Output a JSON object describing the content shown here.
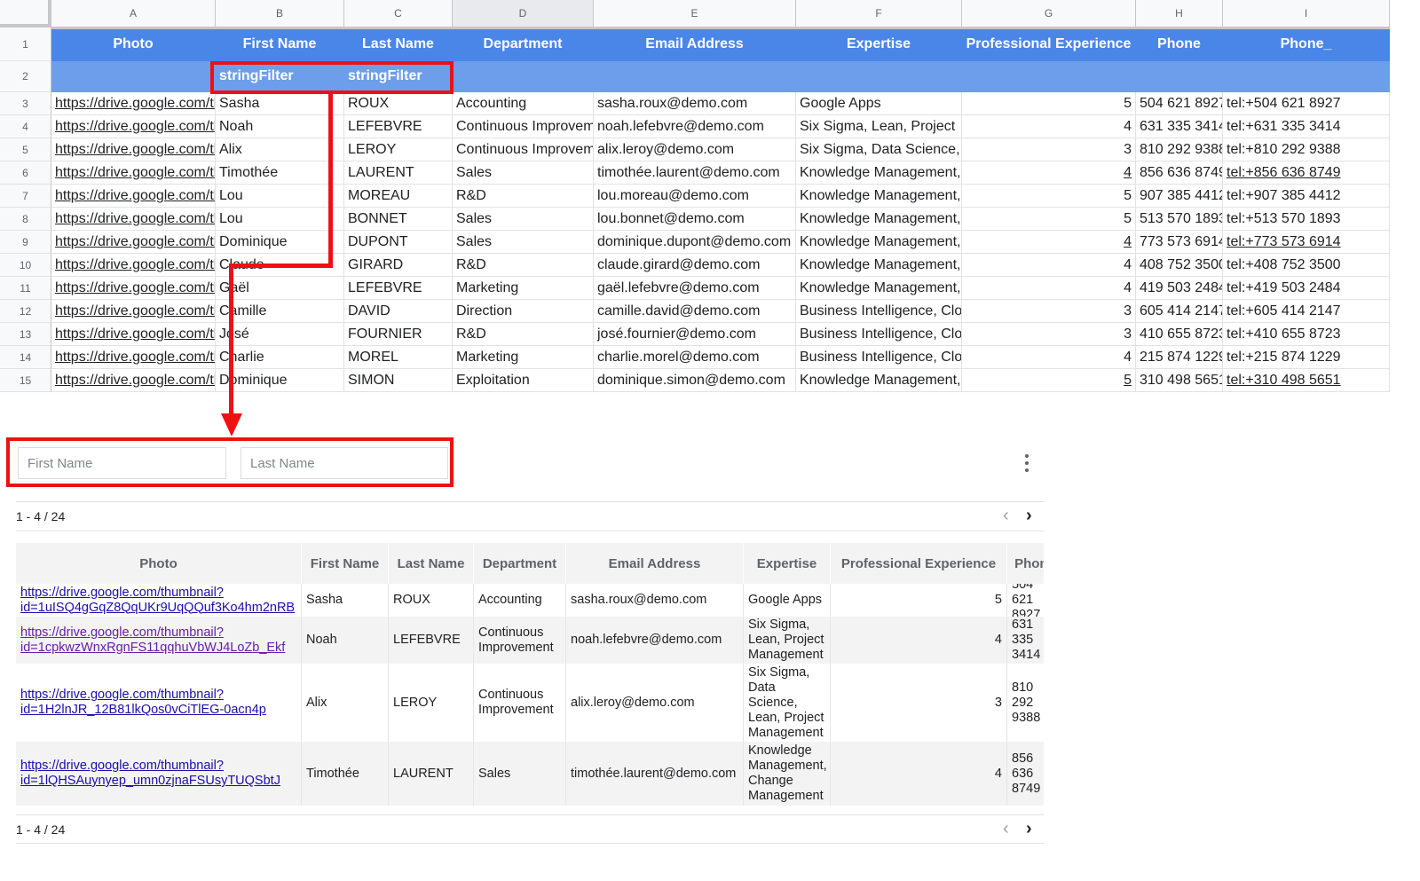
{
  "sheet": {
    "columns": [
      "A",
      "B",
      "C",
      "D",
      "E",
      "F",
      "G",
      "H",
      "I"
    ],
    "row_numbers": [
      "1",
      "2",
      "3",
      "4",
      "5",
      "6",
      "7",
      "8",
      "9",
      "10",
      "11",
      "12",
      "13",
      "14",
      "15"
    ],
    "header": [
      "Photo",
      "First Name",
      "Last Name",
      "Department",
      "Email Address",
      "Expertise",
      "Professional Experience",
      "Phone",
      "Phone_"
    ],
    "filter_row": [
      "",
      "stringFilter",
      "stringFilter",
      "",
      "",
      "",
      "",
      "",
      ""
    ],
    "rows": [
      [
        "https://drive.google.com/tl",
        "Sasha",
        "ROUX",
        "Accounting",
        "sasha.roux@demo.com",
        "Google Apps",
        "5",
        "504 621 8927",
        "tel:+504 621 8927"
      ],
      [
        "https://drive.google.com/tl",
        "Noah",
        "LEFEBVRE",
        "Continuous Improvement",
        "noah.lefebvre@demo.com",
        "Six Sigma, Lean, Project",
        "4",
        "631 335 3414",
        "tel:+631 335 3414"
      ],
      [
        "https://drive.google.com/tl",
        "Alix",
        "LEROY",
        "Continuous Improvement",
        "alix.leroy@demo.com",
        "Six Sigma, Data Science,",
        "3",
        "810 292 9388",
        "tel:+810 292 9388"
      ],
      [
        "https://drive.google.com/tl",
        "Timothée",
        "LAURENT",
        "Sales",
        "timothée.laurent@demo.com",
        "Knowledge Management,",
        "4",
        "856 636 8749",
        "tel:+856 636 8749"
      ],
      [
        "https://drive.google.com/tl",
        "Lou",
        "MOREAU",
        "R&D",
        "lou.moreau@demo.com",
        "Knowledge Management,",
        "5",
        "907 385 4412",
        "tel:+907 385 4412"
      ],
      [
        "https://drive.google.com/tl",
        "Lou",
        "BONNET",
        "Sales",
        "lou.bonnet@demo.com",
        "Knowledge Management,",
        "5",
        "513 570 1893",
        "tel:+513 570 1893"
      ],
      [
        "https://drive.google.com/tl",
        "Dominique",
        "DUPONT",
        "Sales",
        "dominique.dupont@demo.com",
        "Knowledge Management,",
        "4",
        "773 573 6914",
        "tel:+773 573 6914"
      ],
      [
        "https://drive.google.com/tl",
        "Claude",
        "GIRARD",
        "R&D",
        "claude.girard@demo.com",
        "Knowledge Management,",
        "4",
        "408 752 3500",
        "tel:+408 752 3500"
      ],
      [
        "https://drive.google.com/tl",
        "Gaël",
        "LEFEBVRE",
        "Marketing",
        "gaël.lefebvre@demo.com",
        "Knowledge Management,",
        "4",
        "419 503 2484",
        "tel:+419 503 2484"
      ],
      [
        "https://drive.google.com/tl",
        "Camille",
        "DAVID",
        "Direction",
        "camille.david@demo.com",
        "Business Intelligence, Clo",
        "3",
        "605 414 2147",
        "tel:+605 414 2147"
      ],
      [
        "https://drive.google.com/tl",
        "José",
        "FOURNIER",
        "R&D",
        "josé.fournier@demo.com",
        "Business Intelligence, Clo",
        "3",
        "410 655 8723",
        "tel:+410 655 8723"
      ],
      [
        "https://drive.google.com/tl",
        "Charlie",
        "MOREL",
        "Marketing",
        "charlie.morel@demo.com",
        "Business Intelligence, Clo",
        "4",
        "215 874 1229",
        "tel:+215 874 1229"
      ],
      [
        "https://drive.google.com/tl",
        "Dominique",
        "SIMON",
        "Exploitation",
        "dominique.simon@demo.com",
        "Knowledge Management,",
        "5",
        "310 498 5651",
        "tel:+310 498 5651"
      ]
    ],
    "underlined_phone_rows": [
      3,
      6,
      12
    ]
  },
  "filters": {
    "first_name_placeholder": "First Name",
    "last_name_placeholder": "Last Name"
  },
  "pager": {
    "top": "1 - 4 / 24",
    "bottom": "1 - 4 / 24",
    "prev_icon": "‹",
    "next_icon": "›"
  },
  "table": {
    "headers": [
      "Photo",
      "First Name",
      "Last Name",
      "Department",
      "Email Address",
      "Expertise",
      "Professional Experience",
      "Phone"
    ],
    "rows": [
      {
        "photo": "https://drive.google.com/thumbnail?\nid=1uISQ4gGqZ8QqUKr9UqQQuf3Ko4hm2nRB",
        "first": "Sasha",
        "last": "ROUX",
        "dept": "Accounting",
        "email": "sasha.roux@demo.com",
        "expertise": "Google Apps",
        "exp": "5",
        "phone": "504 621\n8927"
      },
      {
        "photo": "https://drive.google.com/thumbnail?\nid=1cpkwzWnxRgnFS11qqhuVbWJ4LoZb_Ekf",
        "first": "Noah",
        "last": "LEFEBVRE",
        "dept": "Continuous\nImprovement",
        "email": "noah.lefebvre@demo.com",
        "expertise": "Six Sigma,\nLean, Project\nManagement",
        "exp": "4",
        "phone": "631 335\n3414"
      },
      {
        "photo": "https://drive.google.com/thumbnail?\nid=1H2lnJR_12B81lkQos0vCiTlEG-0acn4p",
        "first": "Alix",
        "last": "LEROY",
        "dept": "Continuous\nImprovement",
        "email": "alix.leroy@demo.com",
        "expertise": "Six Sigma,\nData\nScience,\nLean, Project\nManagement",
        "exp": "3",
        "phone": "810 292\n9388"
      },
      {
        "photo": "https://drive.google.com/thumbnail?\nid=1lQHSAuynyep_umn0zjnaFSUsyTUQSbtJ",
        "first": "Timothée",
        "last": "LAURENT",
        "dept": "Sales",
        "email": "timothée.laurent@demo.com",
        "expertise": "Knowledge\nManagement,\nChange\nManagement",
        "exp": "4",
        "phone": "856 636\n8749"
      }
    ]
  },
  "colors": {
    "header_blue": "#4a86e8",
    "filter_blue": "#6d9eeb",
    "annotation_red": "#ee1111",
    "link_blue": "#1a0dab",
    "link_visited": "#681da8"
  }
}
